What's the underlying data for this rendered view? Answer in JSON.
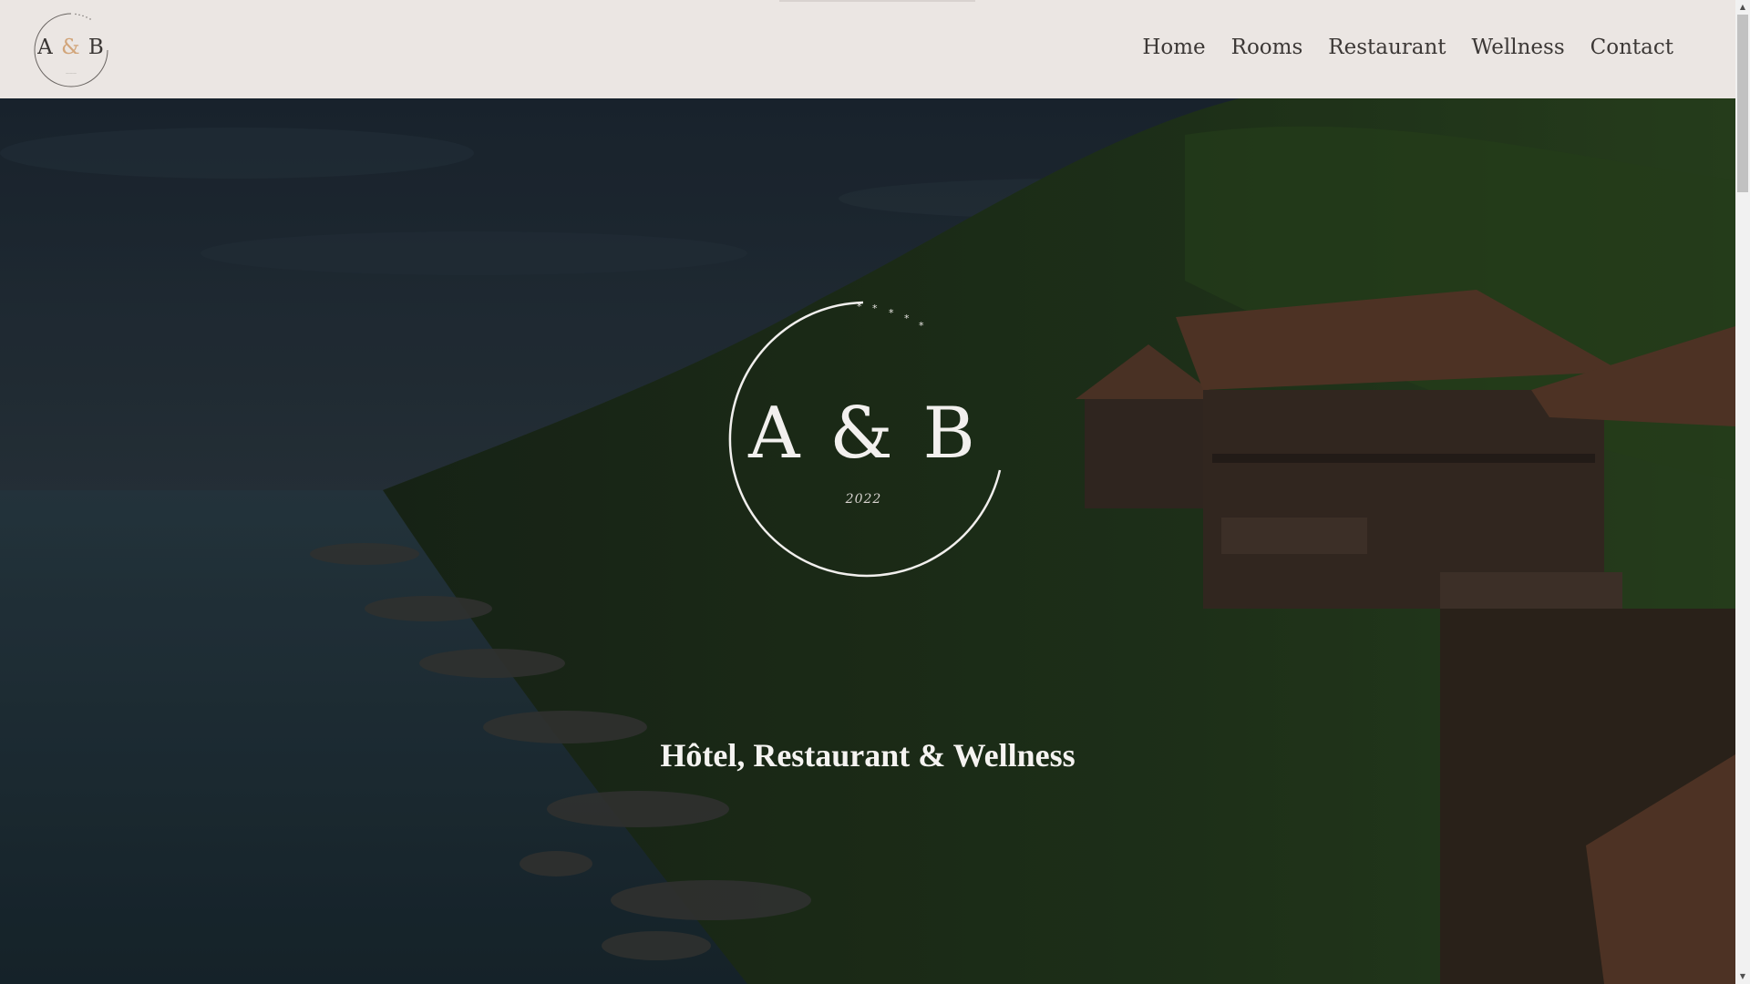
{
  "brand": {
    "logo_letter_a": "A",
    "logo_ampersand": "&",
    "logo_letter_b": "B",
    "hero_logo_text": "A & B",
    "hero_logo_year": "2022",
    "accent_color": "#d2a57a"
  },
  "nav": {
    "items": [
      {
        "label": "Home"
      },
      {
        "label": "Rooms"
      },
      {
        "label": "Restaurant"
      },
      {
        "label": "Wellness"
      },
      {
        "label": "Contact"
      }
    ]
  },
  "hero": {
    "tagline": "Hôtel, Restaurant & Wellness",
    "background": "coastal-hillside-villas-photo"
  },
  "scrollbar": {
    "up_icon": "scroll-up-arrow-icon",
    "down_icon": "scroll-down-arrow-icon"
  }
}
